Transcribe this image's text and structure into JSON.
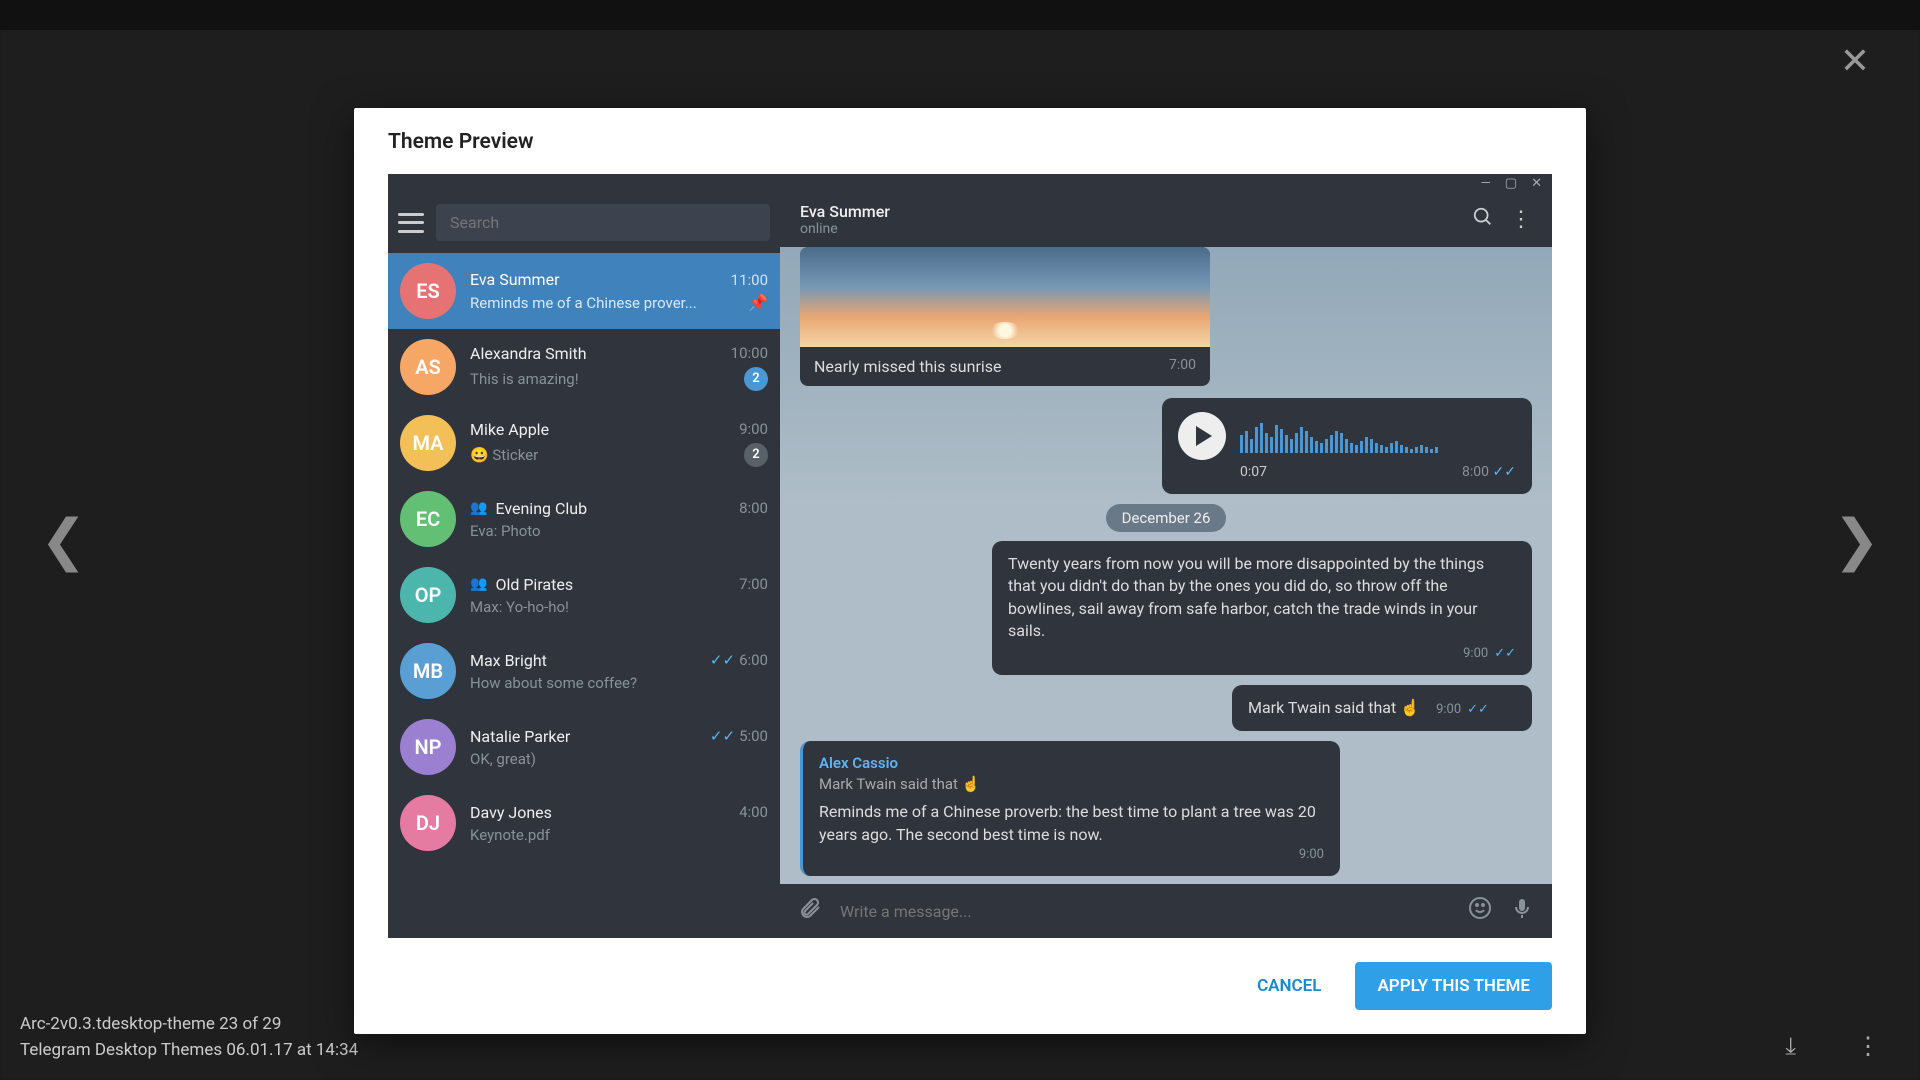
{
  "lightbox": {
    "caption_line1": "Arc-2v0.3.tdesktop-theme 23 of 29",
    "caption_line2": "Telegram Desktop Themes   06.01.17 at 14:34"
  },
  "dialog": {
    "title": "Theme Preview",
    "cancel": "CANCEL",
    "apply": "APPLY THIS THEME"
  },
  "search": {
    "placeholder": "Search"
  },
  "header": {
    "name": "Eva Summer",
    "status": "online"
  },
  "chats": [
    {
      "initials": "ES",
      "color": "#e57373",
      "name": "Eva Summer",
      "time": "11:00",
      "preview": "Reminds me of a Chinese prover...",
      "pinned": true,
      "active": true
    },
    {
      "initials": "AS",
      "color": "#f6a765",
      "name": "Alexandra Smith",
      "time": "10:00",
      "preview": "This is amazing!",
      "badge": "2"
    },
    {
      "initials": "MA",
      "color": "#f3c057",
      "name": "Mike Apple",
      "time": "9:00",
      "preview": "😀 Sticker",
      "badge": "2",
      "muted": true
    },
    {
      "initials": "EC",
      "color": "#63bf74",
      "name": "Evening Club",
      "time": "8:00",
      "preview": "Eva: Photo",
      "group": true
    },
    {
      "initials": "OP",
      "color": "#4db6ac",
      "name": "Old Pirates",
      "time": "7:00",
      "preview": "Max: Yo-ho-ho!",
      "group": true
    },
    {
      "initials": "MB",
      "color": "#5a9fd4",
      "name": "Max Bright",
      "time": "6:00",
      "preview": "How about some coffee?",
      "checks": true
    },
    {
      "initials": "NP",
      "color": "#9b7fd0",
      "name": "Natalie Parker",
      "time": "5:00",
      "preview": "OK, great)",
      "checks": true
    },
    {
      "initials": "DJ",
      "color": "#e57ba1",
      "name": "Davy Jones",
      "time": "4:00",
      "preview": "Keynote.pdf"
    }
  ],
  "messages": {
    "img_caption": "Nearly missed this sunrise",
    "img_time": "7:00",
    "voice_dur": "0:07",
    "voice_time": "8:00",
    "date": "December 26",
    "quote": "Twenty years from now you will be more disappointed by the things that you didn't do than by the ones you did do, so throw off the bowlines, sail away from safe harbor, catch the trade winds in your sails.",
    "quote_time": "9:00",
    "twain": "Mark Twain said that ☝️",
    "twain_time": "9:00",
    "reply_name": "Alex Cassio",
    "reply_quote": "Mark Twain said that ☝️",
    "reply_body": "Reminds me of a Chinese proverb: the best time to plant a tree was 20 years ago. The second best time is now.",
    "reply_time": "9:00"
  },
  "composer": {
    "placeholder": "Write a message..."
  }
}
